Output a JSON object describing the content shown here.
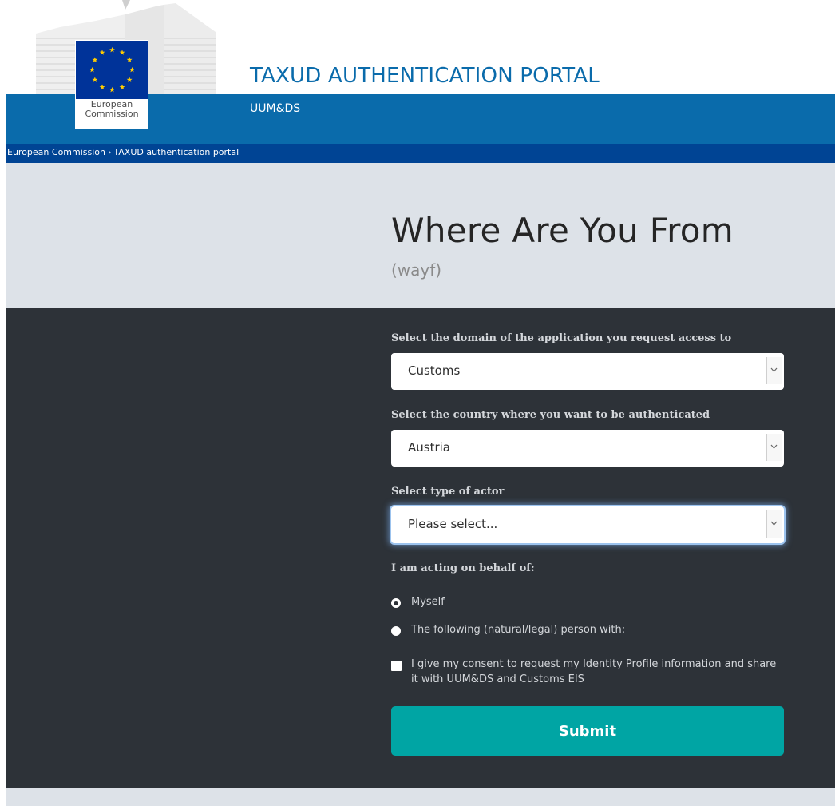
{
  "header": {
    "logo_line1": "European",
    "logo_line2": "Commission",
    "site_title": "TAXUD AUTHENTICATION PORTAL",
    "site_subtitle": "UUM&DS"
  },
  "breadcrumb": {
    "items": [
      "European Commission",
      "TAXUD authentication portal"
    ],
    "separator": "›"
  },
  "page": {
    "title": "Where Are You From",
    "subtitle": "(wayf)"
  },
  "form": {
    "domain_label": "Select the domain of the application you request access to",
    "domain_value": "Customs",
    "country_label": "Select the country where you want to be authenticated",
    "country_value": "Austria",
    "actor_label": "Select type of actor",
    "actor_value": "Please select...",
    "behalf_label": "I am acting on behalf of:",
    "radio_myself": "Myself",
    "radio_other": "The following (natural/legal) person with:",
    "consent_text": "I give my consent to request my Identity Profile information and share it with UUM&DS and Customs EIS",
    "submit_label": "Submit"
  },
  "colors": {
    "header_blue": "#0a6bab",
    "breadcrumb_blue": "#004494",
    "hero_grey": "#dde2e8",
    "panel_dark": "#2d3238",
    "submit_teal": "#00a5a4"
  }
}
